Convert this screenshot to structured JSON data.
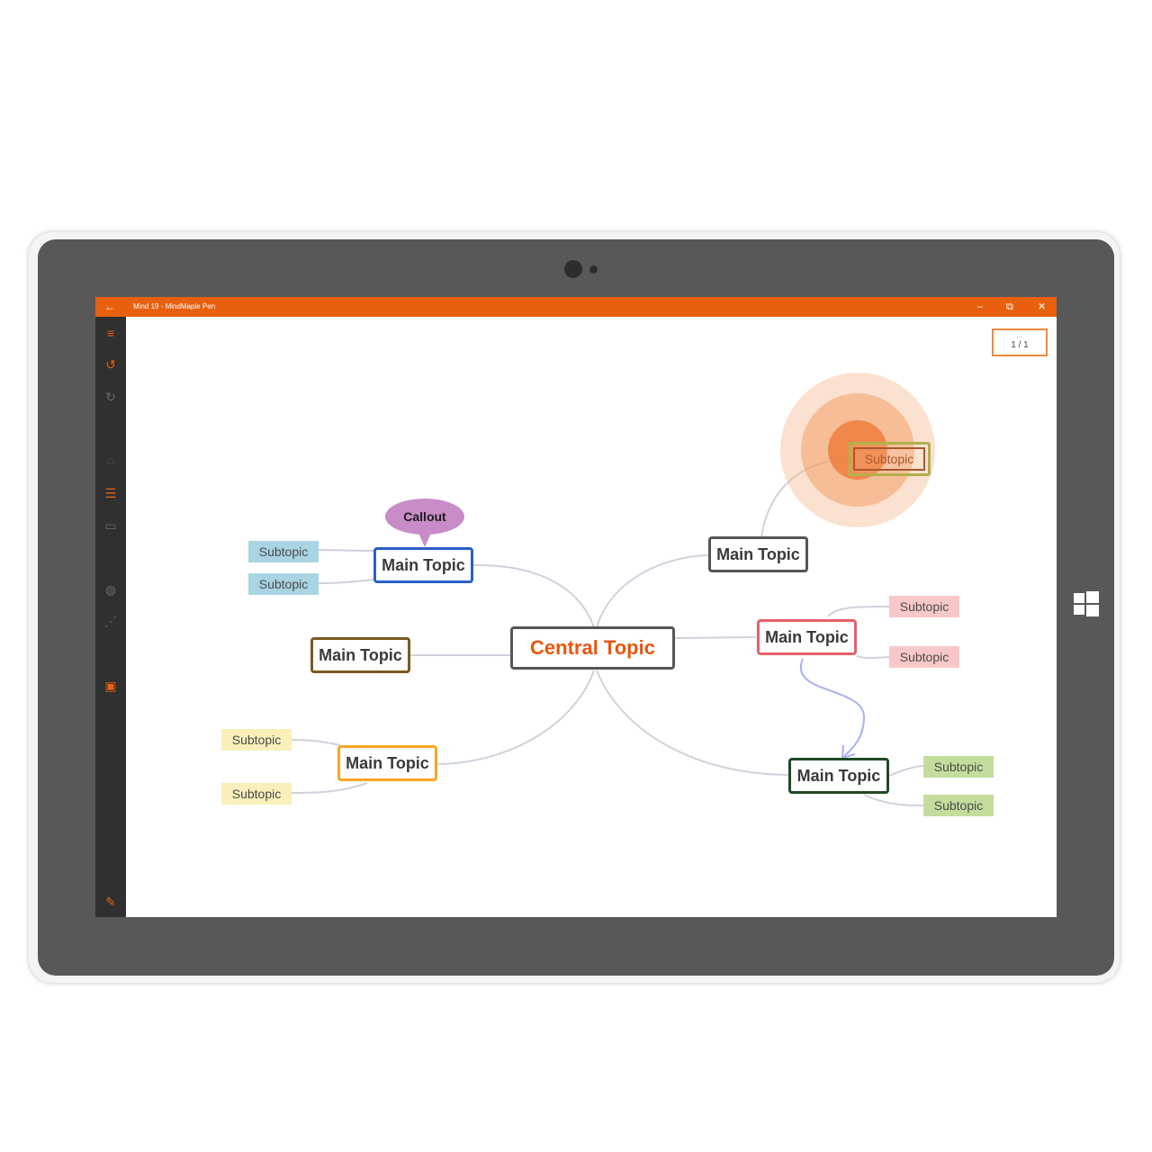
{
  "app": {
    "window_title": "Mind 19 - MindMaple Pen",
    "back_icon": "arrow-left",
    "controls": {
      "minimize": "–",
      "restore": "⧉",
      "close": "✕"
    }
  },
  "sidebar": {
    "items": [
      {
        "icon": "menu-icon",
        "glyph": "≡"
      },
      {
        "icon": "undo-icon",
        "glyph": "↺"
      },
      {
        "icon": "redo-icon",
        "glyph": "↻"
      },
      {
        "icon": "comment-icon",
        "glyph": "◌"
      },
      {
        "icon": "layers-icon",
        "glyph": "☰"
      },
      {
        "icon": "frame-icon",
        "glyph": "▭"
      },
      {
        "icon": "palette-icon",
        "glyph": "◍"
      },
      {
        "icon": "share-icon",
        "glyph": "⋰"
      },
      {
        "icon": "image-icon",
        "glyph": "▣"
      },
      {
        "icon": "pen-icon",
        "glyph": "✎"
      }
    ]
  },
  "page_indicator": {
    "dots": "...",
    "label": "1 / 1"
  },
  "mindmap": {
    "central": "Central Topic",
    "callout": "Callout",
    "main_topic_label": "Main Topic",
    "subtopic_label": "Subtopic"
  },
  "colors": {
    "accent": "#e8600e",
    "central_text": "#e8560c",
    "sub_blue": "#a9d4e3",
    "sub_pink": "#f8c8c8",
    "sub_yellow": "#f8efba",
    "sub_green": "#c3dd9c",
    "callout": "#c88cc8",
    "connector": "#d2d0dc",
    "relationship_arrow": "#a8b0f0"
  },
  "device": {
    "windows_logo_icon": "windows-logo"
  }
}
